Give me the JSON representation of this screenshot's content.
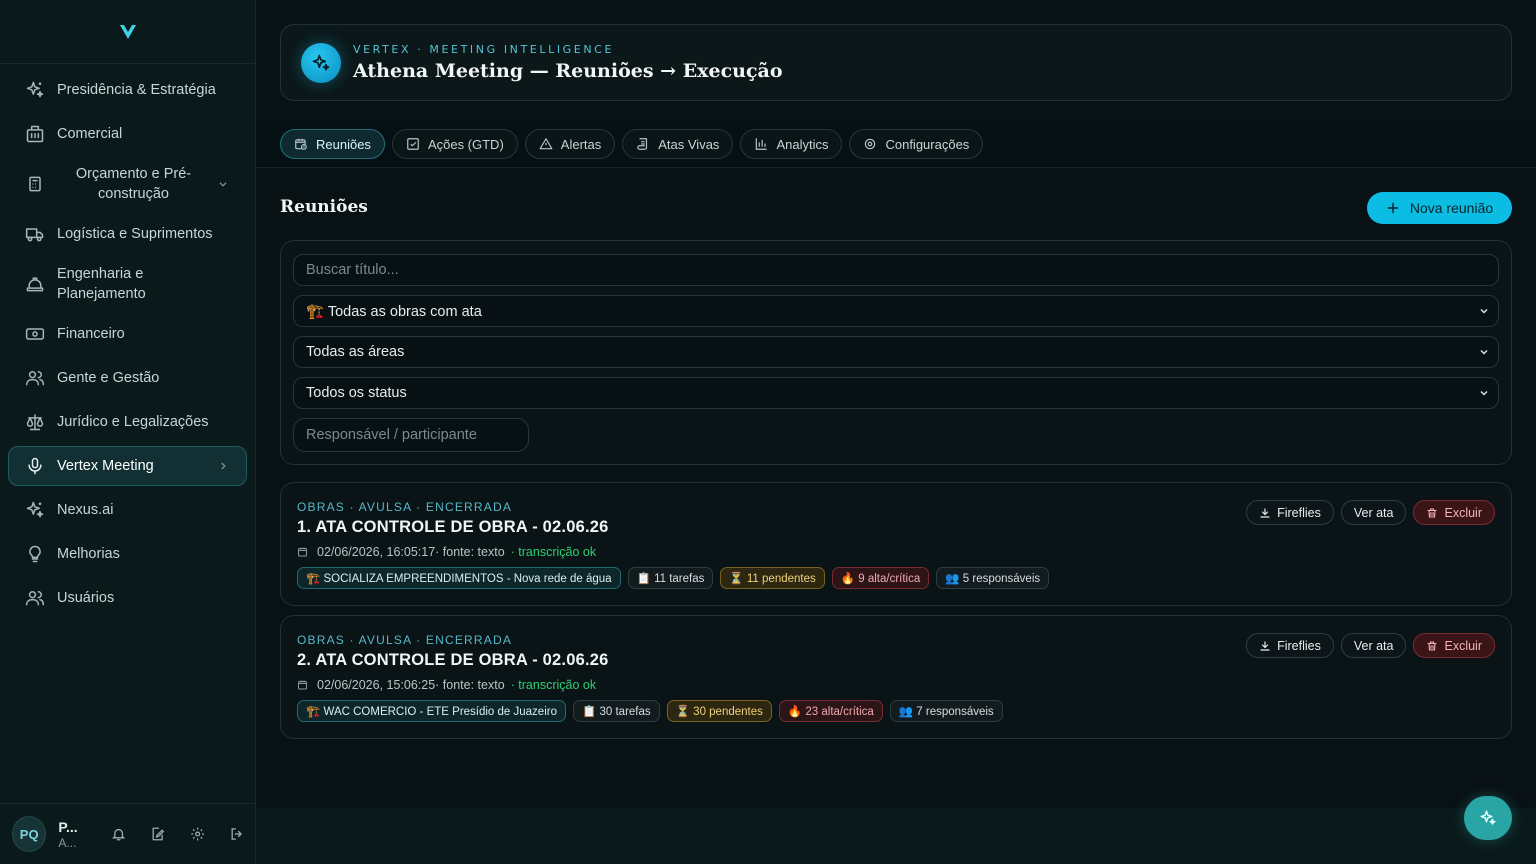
{
  "colors": {
    "accent": "#0bbde3",
    "ok": "#2fcf72",
    "danger": "#7a2a33",
    "pending": "#f0d27a"
  },
  "sidebar": {
    "logo_icon": "vertex-v-logo",
    "items": [
      {
        "label": "Presidência & Estratégia",
        "icon": "sparkles-icon"
      },
      {
        "label": "Comercial",
        "icon": "building-icon"
      },
      {
        "label": "Orçamento e Pré-construção",
        "icon": "calculator-icon"
      },
      {
        "label": "Logística e Suprimentos",
        "icon": "truck-icon"
      },
      {
        "label": "Engenharia e Planejamento",
        "icon": "hardhat-icon"
      },
      {
        "label": "Financeiro",
        "icon": "banknote-icon"
      },
      {
        "label": "Gente e Gestão",
        "icon": "users-icon"
      },
      {
        "label": "Jurídico e Legalizações",
        "icon": "scale-icon"
      },
      {
        "label": "Vertex Meeting",
        "icon": "mic-icon"
      },
      {
        "label": "Nexus.ai",
        "icon": "sparkles-icon"
      },
      {
        "label": "Melhorias",
        "icon": "lightbulb-icon"
      },
      {
        "label": "Usuários",
        "icon": "users-icon"
      }
    ],
    "user": {
      "initials": "PQ",
      "name": "P...",
      "role": "A..."
    }
  },
  "header": {
    "kicker": "VERTEX · MEETING INTELLIGENCE",
    "title": "Athena Meeting — Reuniões → Execução"
  },
  "tabs": [
    {
      "label": "Reuniões",
      "icon": "calendar-clock-icon"
    },
    {
      "label": "Ações (GTD)",
      "icon": "check-square-icon"
    },
    {
      "label": "Alertas",
      "icon": "alert-triangle-icon"
    },
    {
      "label": "Atas Vivas",
      "icon": "scroll-icon"
    },
    {
      "label": "Analytics",
      "icon": "bar-chart-icon"
    },
    {
      "label": "Configurações",
      "icon": "gear-icon"
    }
  ],
  "section": {
    "title": "Reuniões",
    "new_button": "Nova reunião"
  },
  "filters": {
    "search_placeholder": "Buscar título...",
    "obra_select": "🏗️ Todas as obras com ata",
    "area_select": "Todas as áreas",
    "status_select": "Todos os status",
    "participant_placeholder": "Responsável / participante"
  },
  "meetings": [
    {
      "meta": "OBRAS · AVULSA · ENCERRADA",
      "title": "1. ATA CONTROLE DE OBRA - 02.06.26",
      "date": "02/06/2026, 16:05:17· fonte: texto",
      "transcription": "· transcrição ok",
      "obra": "🏗️ SOCIALIZA EMPREENDIMENTOS - Nova rede de água",
      "tasks": "📋 11 tarefas",
      "pending": "⏳ 11 pendentes",
      "critical": "🔥 9 alta/crítica",
      "owners": "👥 5 responsáveis"
    },
    {
      "meta": "OBRAS · AVULSA · ENCERRADA",
      "title": "2. ATA CONTROLE DE OBRA - 02.06.26",
      "date": "02/06/2026, 15:06:25· fonte: texto",
      "transcription": "· transcrição ok",
      "obra": "🏗️ WAC COMERCIO - ETE Presídio de Juazeiro",
      "tasks": "📋 30 tarefas",
      "pending": "⏳ 30 pendentes",
      "critical": "🔥 23 alta/crítica",
      "owners": "👥 7 responsáveis"
    }
  ],
  "card_actions": {
    "fireflies": "Fireflies",
    "view": "Ver ata",
    "delete": "Excluir"
  }
}
